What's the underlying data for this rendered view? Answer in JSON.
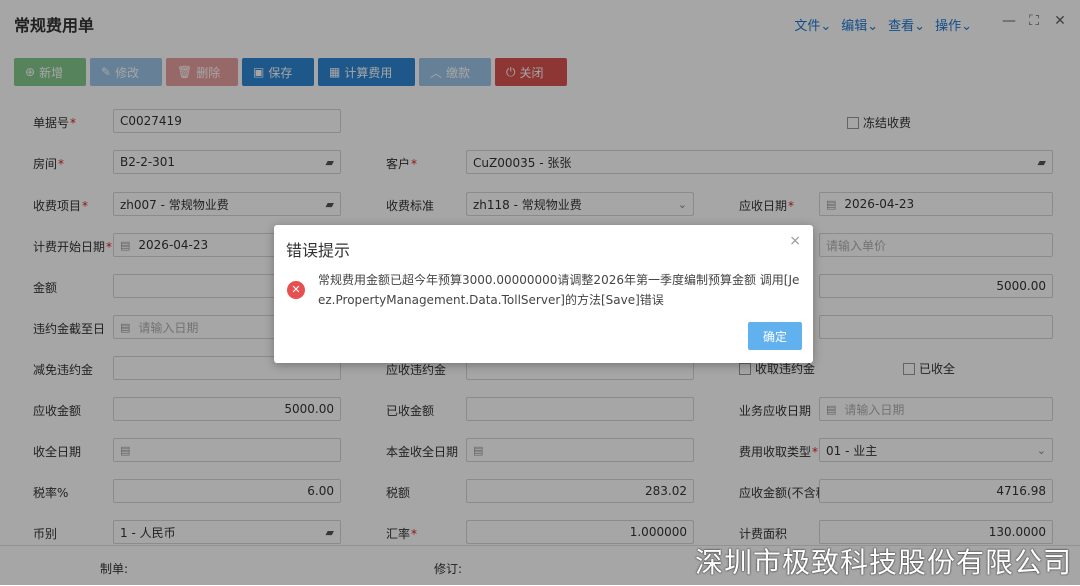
{
  "window": {
    "title": "常规费用单",
    "menus": [
      "文件",
      "编辑",
      "查看",
      "操作"
    ],
    "controls": {
      "minimize": "—",
      "maximize": "⛶",
      "close": "✕"
    }
  },
  "toolbar": {
    "new": "新增",
    "edit": "修改",
    "delete": "删除",
    "save": "保存",
    "calc": "计算费用",
    "pay": "缴款",
    "close": "关闭"
  },
  "form": {
    "bill_no": {
      "label": "单据号",
      "value": "C0027419"
    },
    "freeze": {
      "label": "冻结收费"
    },
    "room": {
      "label": "房间",
      "value": "B2-2-301"
    },
    "customer": {
      "label": "客户",
      "value": "CuZ00035 - 张张"
    },
    "fee_item": {
      "label": "收费项目",
      "value": "zh007 - 常规物业费"
    },
    "fee_standard": {
      "label": "收费标准",
      "value": "zh118 - 常规物业费"
    },
    "due_date": {
      "label": "应收日期",
      "value": "2026-04-23"
    },
    "start_date": {
      "label": "计费开始日期",
      "value": "2026-04-23"
    },
    "unit_price": {
      "placeholder": "请输入单价"
    },
    "amount": {
      "label": "金额",
      "right_value": "5000.00"
    },
    "penalty_until": {
      "label": "违约金截至日",
      "placeholder": "请输入日期"
    },
    "penalty_reduce": {
      "label": "减免违约金"
    },
    "penalty_due": {
      "label": "应收违约金"
    },
    "collect_penalty": {
      "label": "收取违约金"
    },
    "received_flag": {
      "label": "已收全"
    },
    "receivable": {
      "label": "应收金额",
      "value": "5000.00"
    },
    "received": {
      "label": "已收金额",
      "value": ""
    },
    "biz_due_date": {
      "label": "业务应收日期",
      "placeholder": "请输入日期"
    },
    "collect_date": {
      "label": "收全日期"
    },
    "principal_date": {
      "label": "本金收全日期"
    },
    "fee_type": {
      "label": "费用收取类型",
      "value": "01 - 业主"
    },
    "tax_rate": {
      "label": "税率%",
      "value": "6.00"
    },
    "tax": {
      "label": "税额",
      "value": "283.02"
    },
    "amount_ex_tax": {
      "label": "应收金额(不含税)",
      "value": "4716.98"
    },
    "currency": {
      "label": "币别",
      "value": "1 - 人民币"
    },
    "exchange_rate": {
      "label": "汇率",
      "value": "1.000000"
    },
    "area": {
      "label": "计费面积",
      "value": "130.0000"
    }
  },
  "footer": {
    "creator": "制单:",
    "reviser": "修订:"
  },
  "watermark": "深圳市极致科技股份有限公司",
  "dialog": {
    "title": "错误提示",
    "message": "常规费用金额已超今年预算3000.00000000请调整2026年第一季度编制预算金额 调用[Jeez.PropertyManagement.Data.TollServer]的方法[Save]错误",
    "ok": "确定",
    "close": "×"
  },
  "colors": {
    "accent": "#2f86d4",
    "menu": "#1e78d2",
    "error": "#e65050",
    "ok_button": "#62b1ef"
  }
}
